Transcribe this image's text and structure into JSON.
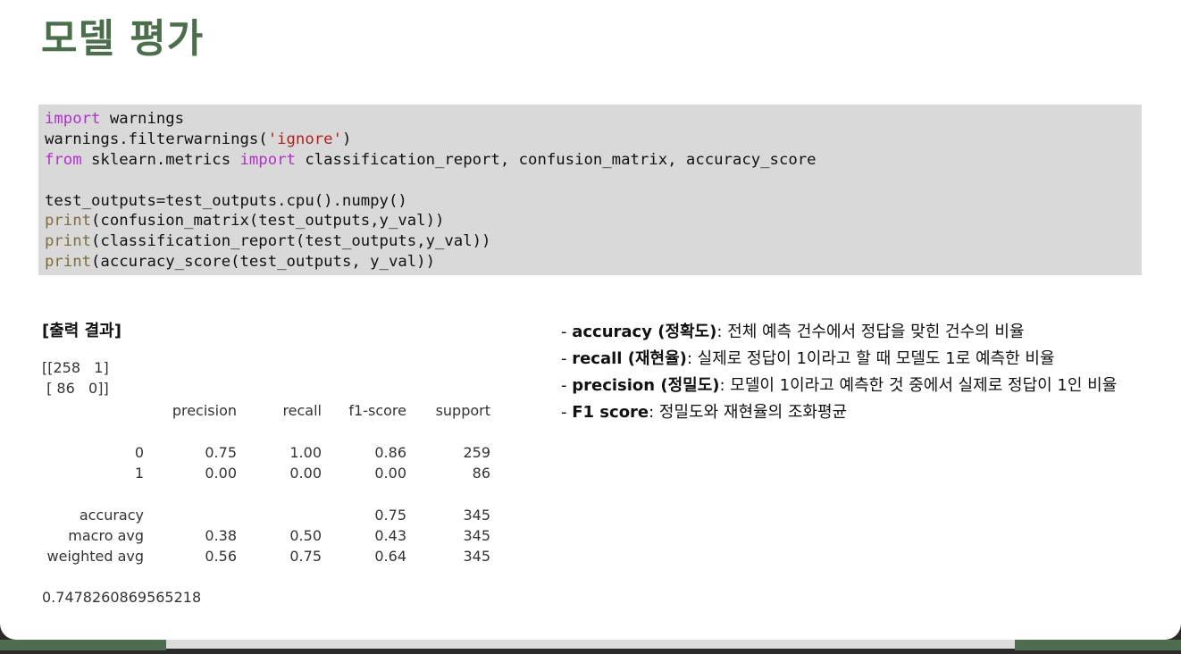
{
  "title": "모델 평가",
  "code": {
    "line1": {
      "kw": "import",
      "rest": " warnings"
    },
    "line2": {
      "pre": "warnings.filterwarnings(",
      "str": "'ignore'",
      "post": ")"
    },
    "line3": {
      "kw1": "from",
      "mid": " sklearn.metrics ",
      "kw2": "import",
      "rest": " classification_report, confusion_matrix, accuracy_score"
    },
    "line4": "test_outputs=test_outputs.cpu().numpy()",
    "line5": {
      "fn": "print",
      "rest": "(confusion_matrix(test_outputs,y_val))"
    },
    "line6": {
      "fn": "print",
      "rest": "(classification_report(test_outputs,y_val))"
    },
    "line7": {
      "fn": "print",
      "rest": "(accuracy_score(test_outputs, y_val))"
    }
  },
  "output": {
    "title": "[출력 결과]",
    "matrix_row1": "[[258   1]",
    "matrix_row2": " [ 86   0]]",
    "headers": {
      "precision": "precision",
      "recall": "recall",
      "f1": "f1-score",
      "support": "support"
    },
    "rows": [
      {
        "label": "0",
        "precision": "0.75",
        "recall": "1.00",
        "f1": "0.86",
        "support": "259"
      },
      {
        "label": "1",
        "precision": "0.00",
        "recall": "0.00",
        "f1": "0.00",
        "support": "86"
      },
      {
        "label": "accuracy",
        "precision": "",
        "recall": "",
        "f1": "0.75",
        "support": "345"
      },
      {
        "label": "macro avg",
        "precision": "0.38",
        "recall": "0.50",
        "f1": "0.43",
        "support": "345"
      },
      {
        "label": "weighted avg",
        "precision": "0.56",
        "recall": "0.75",
        "f1": "0.64",
        "support": "345"
      }
    ],
    "accuracy_value": "0.7478260869565218"
  },
  "notes": [
    {
      "dash": "- ",
      "term": "accuracy (정확도)",
      "desc": ": 전체 예측 건수에서 정답을 맞힌 건수의 비율"
    },
    {
      "dash": "- ",
      "term": "recall (재현율)",
      "desc": ": 실제로 정답이 1이라고 할 때 모델도 1로 예측한 비율"
    },
    {
      "dash": "- ",
      "term": "precision (정밀도)",
      "desc": ": 모델이 1이라고 예측한 것 중에서 실제로 정답이 1인 비율"
    },
    {
      "dash": "- ",
      "term": "F1 score",
      "desc": ": 정밀도와 재현율의 조화평균"
    }
  ],
  "colors": {
    "title": "#4b6e4b",
    "code_bg": "#d9d9d9",
    "keyword": "#b030c8",
    "string": "#b02020",
    "builtin": "#7f6d3d"
  }
}
